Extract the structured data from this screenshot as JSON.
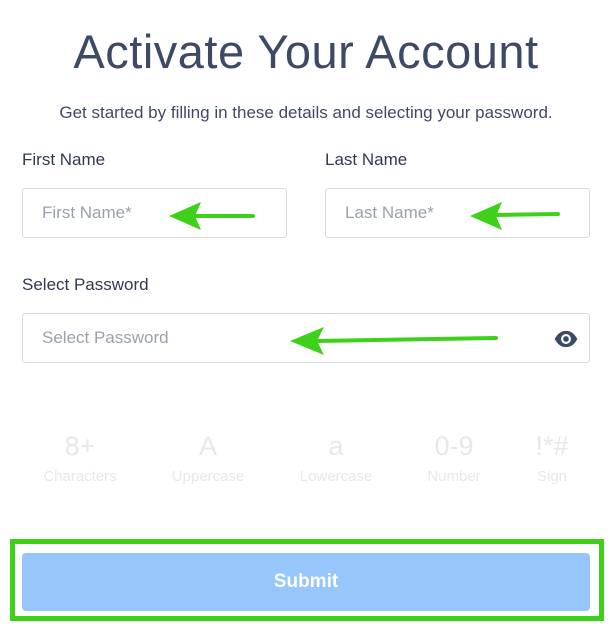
{
  "header": {
    "title": "Activate Your Account",
    "subtitle": "Get started by filling in these details and selecting your password."
  },
  "form": {
    "first_name": {
      "label": "First Name",
      "placeholder": "First Name*",
      "value": ""
    },
    "last_name": {
      "label": "Last Name",
      "placeholder": "Last Name*",
      "value": ""
    },
    "password": {
      "label": "Select Password",
      "placeholder": "Select Password",
      "value": "",
      "toggle_icon": "eye-icon"
    }
  },
  "password_rules": [
    {
      "symbol": "8+",
      "label": "Characters"
    },
    {
      "symbol": "A",
      "label": "Uppercase"
    },
    {
      "symbol": "a",
      "label": "Lowercase"
    },
    {
      "symbol": "0-9",
      "label": "Number"
    },
    {
      "symbol": "!*#",
      "label": "Sign"
    }
  ],
  "submit": {
    "label": "Submit"
  },
  "colors": {
    "annotation": "#3fd11a",
    "submit_bg": "#96c6fb",
    "title_text": "#3d4a66",
    "rule_text_inactive": "#e6e8ee"
  }
}
